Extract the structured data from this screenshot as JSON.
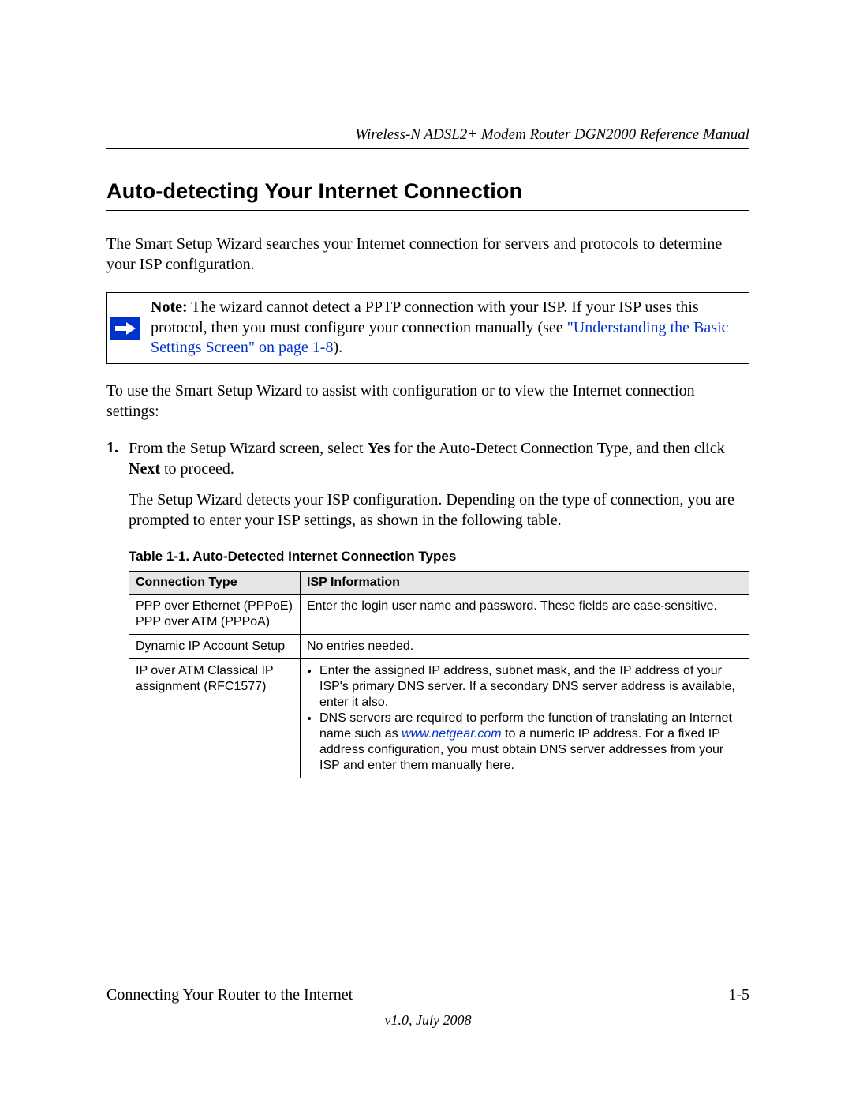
{
  "header": {
    "doc_title": "Wireless-N ADSL2+ Modem Router DGN2000 Reference Manual"
  },
  "section": {
    "title": "Auto-detecting Your Internet Connection",
    "intro": "The Smart Setup Wizard searches your Internet connection for servers and protocols to determine your ISP configuration."
  },
  "note": {
    "label": "Note:",
    "text_before_link": " The wizard cannot detect a PPTP connection with your ISP. If your ISP uses this protocol, then you must configure your connection manually (see ",
    "link_text": "\"Understanding the Basic Settings Screen\" on page 1-8",
    "text_after_link": ")."
  },
  "pre_steps": "To use the Smart Setup Wizard to assist with configuration or to view the Internet connection settings:",
  "steps": {
    "item1": {
      "num": "1.",
      "pre_yes": "From the Setup Wizard screen, select ",
      "yes": "Yes",
      "mid": " for the Auto-Detect Connection Type, and then click ",
      "next": "Next",
      "post": " to proceed.",
      "follow": "The Setup Wizard detects your ISP configuration. Depending on the type of connection, you are prompted to enter your ISP settings, as shown in the following table."
    }
  },
  "table": {
    "caption": "Table 1-1. Auto-Detected Internet Connection Types",
    "headers": {
      "c1": "Connection Type",
      "c2": "ISP Information"
    },
    "rows": {
      "r1": {
        "c1a": "PPP over Ethernet (PPPoE)",
        "c1b": "PPP over ATM (PPPoA)",
        "c2": "Enter the login user name and password. These fields are case-sensitive."
      },
      "r2": {
        "c1": "Dynamic IP Account Setup",
        "c2": "No entries needed."
      },
      "r3": {
        "c1a": "IP over ATM Classical IP",
        "c1b": "assignment (RFC1577)",
        "b1": "Enter the assigned IP address, subnet mask, and the IP address of your ISP's primary DNS server. If a secondary DNS server address is available, enter it also.",
        "b2_pre": "DNS servers are required to perform the function of translating an Internet name such as ",
        "b2_link": "www.netgear.com",
        "b2_post": " to a numeric IP address. For a fixed IP address configuration, you must obtain DNS server addresses from your ISP and enter them manually here."
      }
    }
  },
  "footer": {
    "chapter": "Connecting Your Router to the Internet",
    "page": "1-5",
    "version": "v1.0, July 2008"
  }
}
